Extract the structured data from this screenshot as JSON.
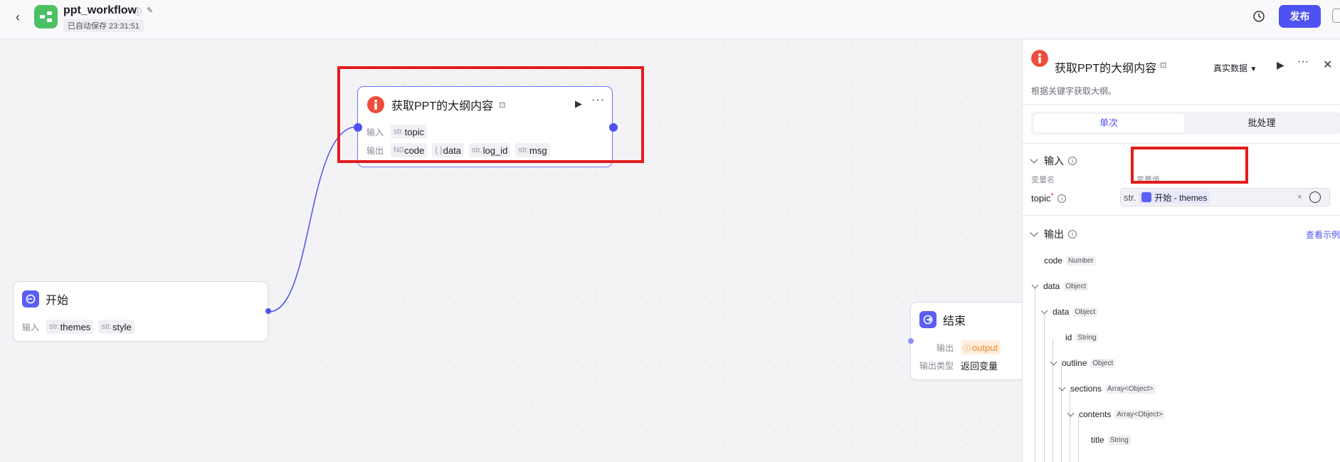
{
  "header": {
    "app_title": "ppt_workflow",
    "saved_status": "已自动保存 23:31:51",
    "publish_label": "发布"
  },
  "nodes": {
    "get_outline": {
      "title": "获取PPT的大纲内容",
      "input_label": "输入",
      "output_label": "输出",
      "inputs": [
        {
          "type": "str.",
          "name": "topic"
        }
      ],
      "outputs": [
        {
          "type": "N0",
          "name": "code"
        },
        {
          "type": "{ }",
          "name": "data"
        },
        {
          "type": "str.",
          "name": "log_id"
        },
        {
          "type": "str.",
          "name": "msg"
        }
      ]
    },
    "start": {
      "title": "开始",
      "input_label": "输入",
      "inputs": [
        {
          "type": "str.",
          "name": "themes"
        },
        {
          "type": "str.",
          "name": "style"
        }
      ]
    },
    "end": {
      "title": "结束",
      "output_label": "输出",
      "output_var": "output",
      "output_type_label": "输出类型",
      "output_type_value": "返回变量"
    }
  },
  "panel": {
    "title": "获取PPT的大纲内容",
    "description": "根据关键字获取大纲。",
    "data_mode": "真实数据",
    "tabs": [
      "单次",
      "批处理"
    ],
    "input_section": "输入",
    "var_name_label": "变量名",
    "var_value_label": "变量值",
    "var_name": "topic",
    "var_required": "*",
    "var_type": "str.",
    "var_ref": "开始 - themes",
    "output_section": "输出",
    "see_example": "查看示例",
    "output_tree": [
      {
        "name": "code",
        "type": "Number"
      },
      {
        "name": "data",
        "type": "Object"
      },
      {
        "name": "data",
        "type": "Object"
      },
      {
        "name": "id",
        "type": "String"
      },
      {
        "name": "outline",
        "type": "Object"
      },
      {
        "name": "sections",
        "type": "Array<Object>"
      },
      {
        "name": "contents",
        "type": "Array<Object>"
      },
      {
        "name": "title",
        "type": "String"
      }
    ]
  },
  "colors": {
    "accent": "#4e52f2",
    "highlight": "#e21c1c",
    "start_icon": "#5a5ff3",
    "plugin_icon": "#f04c3c",
    "end_output": "#f5872a"
  }
}
